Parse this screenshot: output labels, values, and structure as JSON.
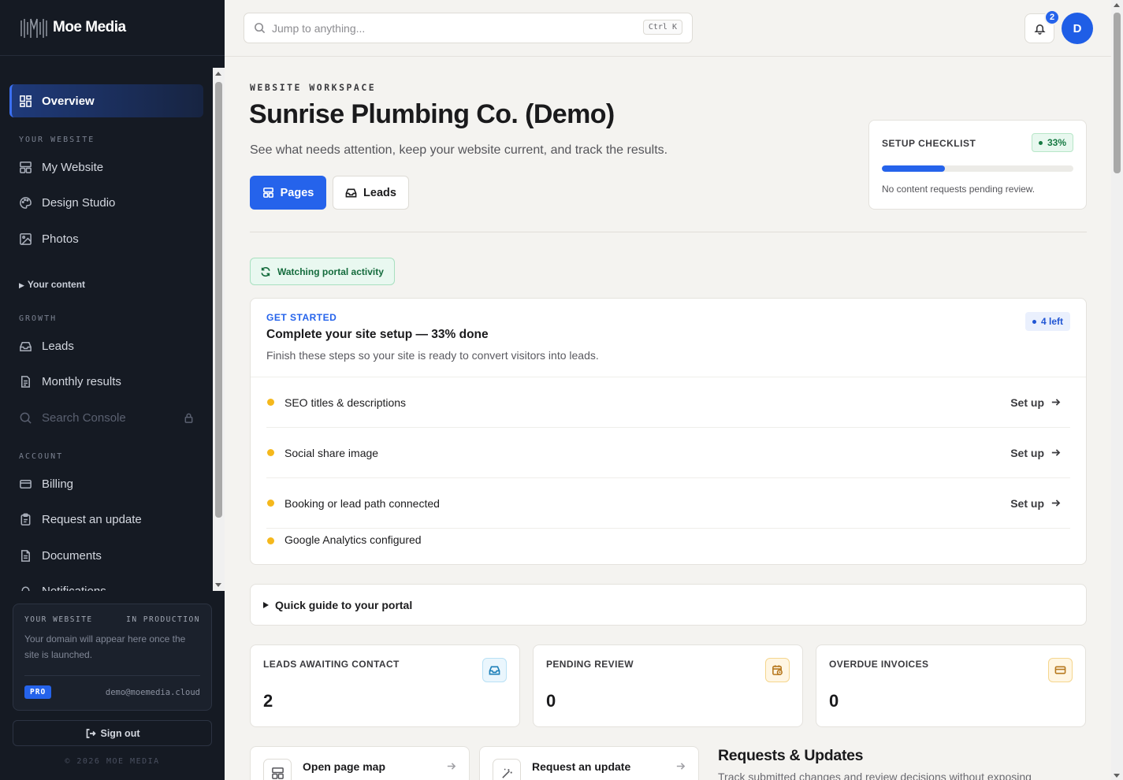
{
  "brand": {
    "name": "Moe Media"
  },
  "sidebar": {
    "overview": "Overview",
    "section_website": "YOUR WEBSITE",
    "my_website": "My Website",
    "design_studio": "Design Studio",
    "photos": "Photos",
    "your_content": "Your content",
    "section_growth": "GROWTH",
    "leads": "Leads",
    "monthly_results": "Monthly results",
    "search_console": "Search Console",
    "section_account": "ACCOUNT",
    "billing": "Billing",
    "request_update": "Request an update",
    "documents": "Documents",
    "notifications": "Notifications"
  },
  "site_card": {
    "label": "YOUR WEBSITE",
    "status": "IN PRODUCTION",
    "body": "Your domain will appear here once the site is launched.",
    "plan": "PRO",
    "email": "demo@moemedia.cloud"
  },
  "signout": "Sign out",
  "copyright": "© 2026 MOE MEDIA",
  "topbar": {
    "search_placeholder": "Jump to anything...",
    "shortcut": "Ctrl K",
    "notification_count": "2",
    "avatar_initial": "D"
  },
  "header": {
    "eyebrow": "WEBSITE WORKSPACE",
    "title": "Sunrise Plumbing Co. (Demo)",
    "subtitle": "See what needs attention, keep your website current, and track the results.",
    "btn_pages": "Pages",
    "btn_leads": "Leads"
  },
  "checklist": {
    "label": "SETUP CHECKLIST",
    "percent_label": "33%",
    "progress": 0.33,
    "note": "No content requests pending review."
  },
  "watching": "Watching portal activity",
  "setup": {
    "kicker": "GET STARTED",
    "title": "Complete your site setup — 33% done",
    "description": "Finish these steps so your site is ready to convert visitors into leads.",
    "remaining": "4 left",
    "tasks": [
      {
        "label": "SEO titles & descriptions",
        "action": "Set up"
      },
      {
        "label": "Social share image",
        "action": "Set up"
      },
      {
        "label": "Booking or lead path connected",
        "action": "Set up"
      },
      {
        "label": "Google Analytics configured",
        "action": ""
      }
    ]
  },
  "guide": "Quick guide to your portal",
  "stats": [
    {
      "label": "LEADS AWAITING CONTACT",
      "value": "2"
    },
    {
      "label": "PENDING REVIEW",
      "value": "0"
    },
    {
      "label": "OVERDUE INVOICES",
      "value": "0"
    }
  ],
  "quick_actions": [
    {
      "label": "Open page map"
    },
    {
      "label": "Request an update"
    }
  ],
  "requests": {
    "title": "Requests & Updates",
    "description": "Track submitted changes and review decisions without exposing"
  },
  "colors": {
    "accent": "#2563eb",
    "sidebar_bg": "#151a23",
    "page_bg": "#f4f3f0",
    "success": "#177a43",
    "warning_dot": "#f5b81c"
  },
  "icons": {
    "overview": "grid-icon",
    "my_website": "layout-icon",
    "design_studio": "palette-icon",
    "photos": "image-icon",
    "leads": "inbox-icon",
    "monthly_results": "document-icon",
    "search_console": "search-icon",
    "billing": "credit-card-icon",
    "request_update": "clipboard-icon",
    "documents": "file-icon"
  }
}
